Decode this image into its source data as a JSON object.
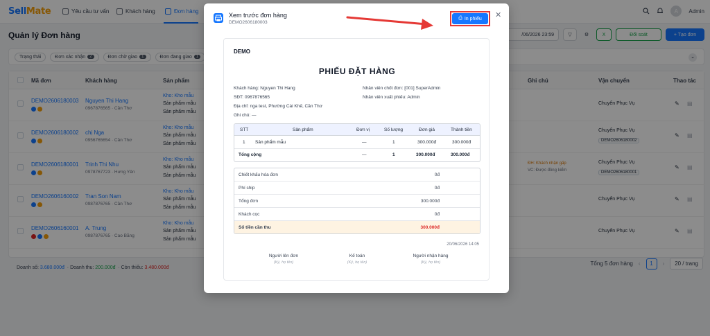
{
  "app": {
    "logo_main": "Sell",
    "logo_accent": "Mate"
  },
  "nav": [
    {
      "label": "Yêu cầu tư vấn"
    },
    {
      "label": "Khách hàng"
    },
    {
      "label": "Đơn hàng"
    }
  ],
  "user": {
    "avatar_letter": "A",
    "name": "Admin"
  },
  "page": {
    "title": "Quản lý Đơn hàng"
  },
  "toolbar": {
    "date_range": "/06/2026 23:59",
    "excel": "X",
    "sync_label": "Đối soát",
    "create_label": "+ Tạo đơn"
  },
  "filters": [
    {
      "label": "Trạng thái",
      "count": ""
    },
    {
      "label": "Đơn xác nhận",
      "count": "2"
    },
    {
      "label": "Đơn chờ giao",
      "count": "1"
    },
    {
      "label": "Đơn đang giao",
      "count": "1"
    }
  ],
  "table": {
    "headers": [
      "Mã đơn",
      "Khách hàng",
      "Sản phẩm",
      "Ghi chú",
      "Vận chuyển",
      "Thao tác"
    ],
    "rows": [
      {
        "code": "DEMO2606180003",
        "customer": "Nguyen Thi Hang",
        "phone": "0967876565 · Cần Thơ",
        "warehouse": "Kho: Kho mẫu",
        "p1": "Sản phẩm mẫu",
        "p2": "Sản phẩm mẫu",
        "note": "",
        "note2": "",
        "ship": "Chuyển Phục Vụ",
        "ship_code": ""
      },
      {
        "code": "DEMO2606180002",
        "customer": "chị Nga",
        "phone": "0956765654 · Cần Thơ",
        "warehouse": "Kho: Kho mẫu",
        "p1": "Sản phẩm mẫu",
        "p2": "Sản phẩm mẫu",
        "note": "",
        "note2": "",
        "ship": "Chuyển Phục Vụ",
        "ship_code": "DEMO2606180002"
      },
      {
        "code": "DEMO2606180001",
        "customer": "Trinh Thi Nhu",
        "phone": "0978767723 · Hưng Yên",
        "warehouse": "Kho: Kho mẫu",
        "p1": "Sản phẩm mẫu",
        "p2": "Sản phẩm mẫu",
        "note": "ĐH: Khách nhận gấp",
        "note2": "VC: Được đồng kiểm",
        "ship": "Chuyển Phục Vụ",
        "ship_code": "DEMO2606180001"
      },
      {
        "code": "DEMO2606160002",
        "customer": "Tran Son Nam",
        "phone": "0987876765 · Cần Thơ",
        "warehouse": "Kho: Kho mẫu",
        "p1": "Sản phẩm mẫu",
        "p2": "Sản phẩm mẫu",
        "note": "",
        "note2": "",
        "ship": "Chuyển Phục Vụ",
        "ship_code": ""
      },
      {
        "code": "DEMO2606160001",
        "customer": "A. Trung",
        "phone": "0987876765 · Cao Bằng",
        "warehouse": "Kho: Kho mẫu",
        "p1": "Sản phẩm mẫu",
        "p2": "Sản phẩm mẫu",
        "note": "",
        "note2": "",
        "ship": "Chuyển Phục Vụ",
        "ship_code": ""
      }
    ]
  },
  "summary": {
    "sales_label": "Doanh số: ",
    "sales": "3.680.000đ",
    "revenue_label": "Doanh thu: ",
    "revenue": "200.000đ",
    "remain_label": "Còn thiếu: ",
    "remain": "3.480.000đ"
  },
  "pager": {
    "total": "Tổng 5 đơn hàng",
    "current": "1",
    "per_page": "20 / trang"
  },
  "modal": {
    "title": "Xem trước đơn hàng",
    "subtitle": "DEMO2606180003",
    "print_label": "In phiếu",
    "shop": "DEMO",
    "doc_title": "PHIẾU ĐẶT HÀNG",
    "customer": "Khách hàng: Nguyen Thi Hang",
    "phone": "SĐT: 0967876565",
    "address": "Địa chỉ: nga test, Phường Cái Khế, Cần Thơ",
    "note": "Ghi chú: —",
    "staff": "Nhân viên chốt đơn: [001] SuperAdmin",
    "issuer": "Nhân viên xuất phiếu: Admin",
    "items_head": [
      "STT",
      "Sản phẩm",
      "Đơn vị",
      "Số lượng",
      "Đơn giá",
      "Thành tiền"
    ],
    "item": [
      "1",
      "Sản phẩm mẫu",
      "—",
      "1",
      "300.000đ",
      "300.000đ"
    ],
    "total_row": [
      "Tổng cộng",
      "—",
      "1",
      "300.000đ",
      "300.000đ"
    ],
    "totals": [
      {
        "label": "Chiết khấu hóa đơn",
        "value": "0đ"
      },
      {
        "label": "Phí ship",
        "value": "0đ"
      },
      {
        "label": "Tổng đơn",
        "value": "300.000đ"
      },
      {
        "label": "Khách cọc",
        "value": "0đ"
      },
      {
        "label": "Số tiền cần thu",
        "value": "300.000đ"
      }
    ],
    "timestamp": "20/06/2026 14:05",
    "signatures": [
      {
        "title": "Người lên đơn",
        "hint": "(Ký, họ tên)"
      },
      {
        "title": "Kế toán",
        "hint": "(Ký, họ tên)"
      },
      {
        "title": "Người nhận hàng",
        "hint": "(Ký, họ tên)"
      }
    ]
  },
  "colors": {
    "primary": "#1677ff",
    "highlight": "#e53935",
    "due_bg": "#fef3e2"
  }
}
